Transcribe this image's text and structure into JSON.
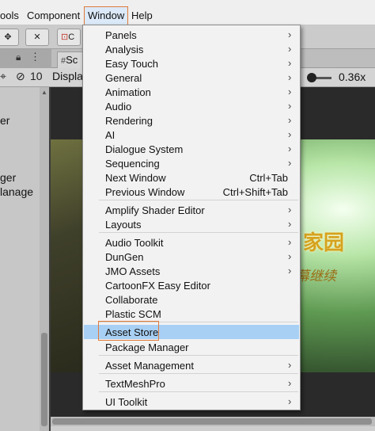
{
  "menubar": {
    "items": [
      "ools",
      "Component",
      "Window",
      "Help"
    ]
  },
  "toolbar": {
    "btn_c": "C"
  },
  "tabs": {
    "scene": "Sc"
  },
  "scene_bar": {
    "display": "Displa",
    "layer_count": "10",
    "zoom": "0.36x"
  },
  "hierarchy": {
    "lines": [
      "er",
      "ger",
      "lanage"
    ]
  },
  "game": {
    "title": "家园",
    "subtitle": "幕继续"
  },
  "window_menu": {
    "items": [
      {
        "label": "Panels",
        "arrow": true
      },
      {
        "label": "Analysis",
        "arrow": true
      },
      {
        "label": "Easy Touch",
        "arrow": true
      },
      {
        "label": "General",
        "arrow": true
      },
      {
        "label": "Animation",
        "arrow": true
      },
      {
        "label": "Audio",
        "arrow": true
      },
      {
        "label": "Rendering",
        "arrow": true
      },
      {
        "label": "AI",
        "arrow": true
      },
      {
        "label": "Dialogue System",
        "arrow": true
      },
      {
        "label": "Sequencing",
        "arrow": true
      },
      {
        "label": "Next Window",
        "shortcut": "Ctrl+Tab"
      },
      {
        "label": "Previous Window",
        "shortcut": "Ctrl+Shift+Tab"
      },
      {
        "label": "Amplify Shader Editor",
        "arrow": true
      },
      {
        "label": "Layouts",
        "arrow": true
      },
      {
        "label": "Audio Toolkit",
        "arrow": true
      },
      {
        "label": "DunGen",
        "arrow": true
      },
      {
        "label": "JMO Assets",
        "arrow": true
      },
      {
        "label": "CartoonFX Easy Editor"
      },
      {
        "label": "Collaborate"
      },
      {
        "label": "Plastic SCM"
      },
      {
        "label": "Asset Store",
        "highlighted": true
      },
      {
        "label": "Package Manager"
      },
      {
        "label": "Asset Management",
        "arrow": true
      },
      {
        "label": "TextMeshPro",
        "arrow": true
      },
      {
        "label": "UI Toolkit",
        "arrow": true
      }
    ],
    "arrow_glyph": "›"
  },
  "colors": {
    "highlight": "#a8d0f5",
    "callout_border": "#e07b39"
  }
}
